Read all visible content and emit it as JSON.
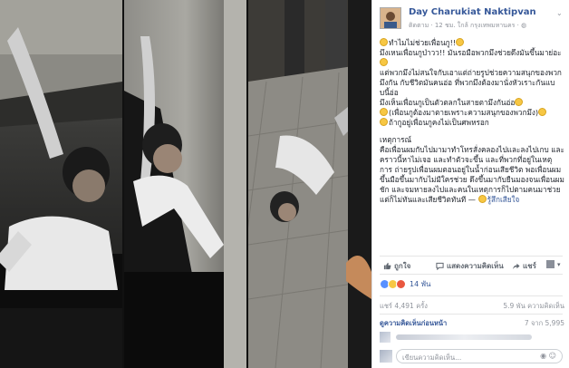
{
  "post": {
    "author": "Day Charukiat Naktipvan",
    "meta": "ติดตาม · 12 ชม. ใกล้ กรุงเทพมหานคร · ",
    "lines": [
      "ทำไมไม่ช่วยเพื่อนกู!!",
      "มึงเหนเพื่อนกูป่าวว!! มันรอมือพวกมึงช่วยดึงมันขึ้นมาย่อะ",
      "แต่พวกมึงไม่สนใจกับเอาแต่ถ่ายรูปช่วยความสนุกของพวกมึงกัน กับชีวิตมันคนอ่อ ที่พวกมึงต้องมานั่งหัวเราะกันแบบนี้อ่อ",
      "มึงเห็นเพื่อนกูเป็นตัวตลกในสายตามึงกันอ่อ",
      "(เพื่อนกูต้องมาตายเพราะความสนุกของพวกมึง)",
      "ถ้ากูอยู่เพื่อนกูคงไม่เป็นศพหรอก"
    ],
    "lines2": [
      "เหตุการณ์",
      "คือเพื่อนผมกับไปมามาทำโทรสั่งคลองไปและลงไปเกบ และคราวนี้หาไม่เจอ และทำตัวจะขึ้น และที่พวกที่อยู่ในเหตุการ ถ่ายรูปเพื่อนผมตอนอยู่ในน้ำก่อนเสียชีวิต พอเพื่อนผมขึ้นมือขึ้นมากับไม่มีใครช่วย ดึงขึ้นมากับยืนมองจนเพื่อนผมชัก และจมหายลงไปและคนในเหตุการก็ไปตามคนมาช่วยแต่ก็ไม่ทันและเสียชีวิตทันที —"
    ],
    "feeling": "รู้สึกเสียใจ"
  },
  "actions": {
    "like": "ถูกใจ",
    "comment": "แสดงความคิดเห็น",
    "share": "แชร์"
  },
  "reactions": {
    "count": "14 พัน"
  },
  "stats": {
    "shares": "แชร์ 4,491 ครั้ง",
    "comments": "5.9 พัน ความคิดเห็น"
  },
  "more_comments": {
    "label": "ดูความคิดเห็นก่อนหน้า",
    "count": "7 จาก 5,995"
  },
  "composer": {
    "placeholder": "เขียนความคิดเห็น..."
  },
  "colors": {
    "link": "#365899",
    "muted": "#90949c",
    "like_blue": "#5890ff",
    "haha_yellow": "#f7c744",
    "angry_red": "#e9573f"
  }
}
